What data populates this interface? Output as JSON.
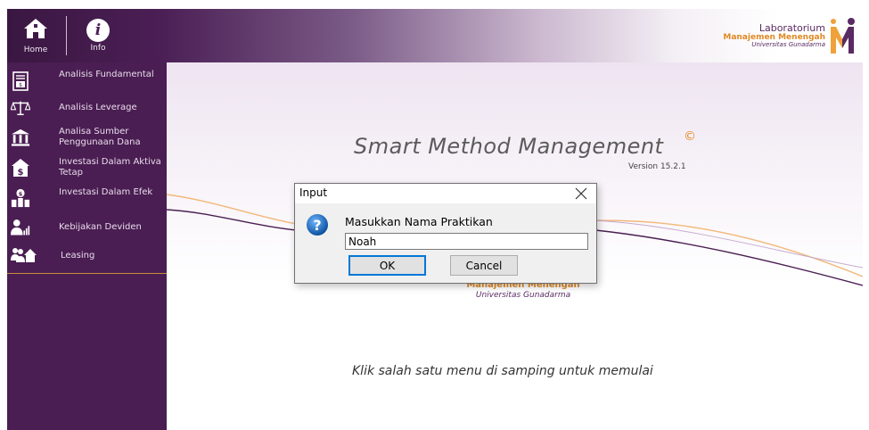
{
  "header": {
    "home_label": "Home",
    "info_label": "Info",
    "brand_line1": "Laboratorium",
    "brand_line2": "Manajemen Menengah",
    "brand_line3": "Universitas Gunadarma"
  },
  "sidebar": {
    "items": [
      {
        "label": "Analisis Fundamental",
        "icon": "calculator-document-icon"
      },
      {
        "label": "Analisis Leverage",
        "icon": "balance-scale-icon"
      },
      {
        "label": "Analisa Sumber Penggunaan Dana",
        "icon": "bank-building-icon"
      },
      {
        "label": "Investasi Dalam Aktiva Tetap",
        "icon": "house-dollar-icon"
      },
      {
        "label": "Investasi Dalam Efek",
        "icon": "buildings-dollar-icon"
      },
      {
        "label": "Kebijakan Deviden",
        "icon": "person-chart-icon"
      },
      {
        "label": "Leasing",
        "icon": "people-house-icon"
      }
    ]
  },
  "main": {
    "title": "Smart Method Management",
    "copyright_symbol": "©",
    "version": "Version 15.2.1",
    "lab_line2": "Manajemen Menengah",
    "lab_line3": "Universitas Gunadarma",
    "instruction": "Klik salah satu menu di samping untuk memulai"
  },
  "dialog": {
    "title": "Input",
    "prompt": "Masukkan Nama Praktikan",
    "input_value": "Noah",
    "ok_label": "OK",
    "cancel_label": "Cancel"
  },
  "colors": {
    "sidebar_bg": "#4a1e52",
    "accent_orange": "#e08a25",
    "brand_purple": "#5a2a63"
  }
}
